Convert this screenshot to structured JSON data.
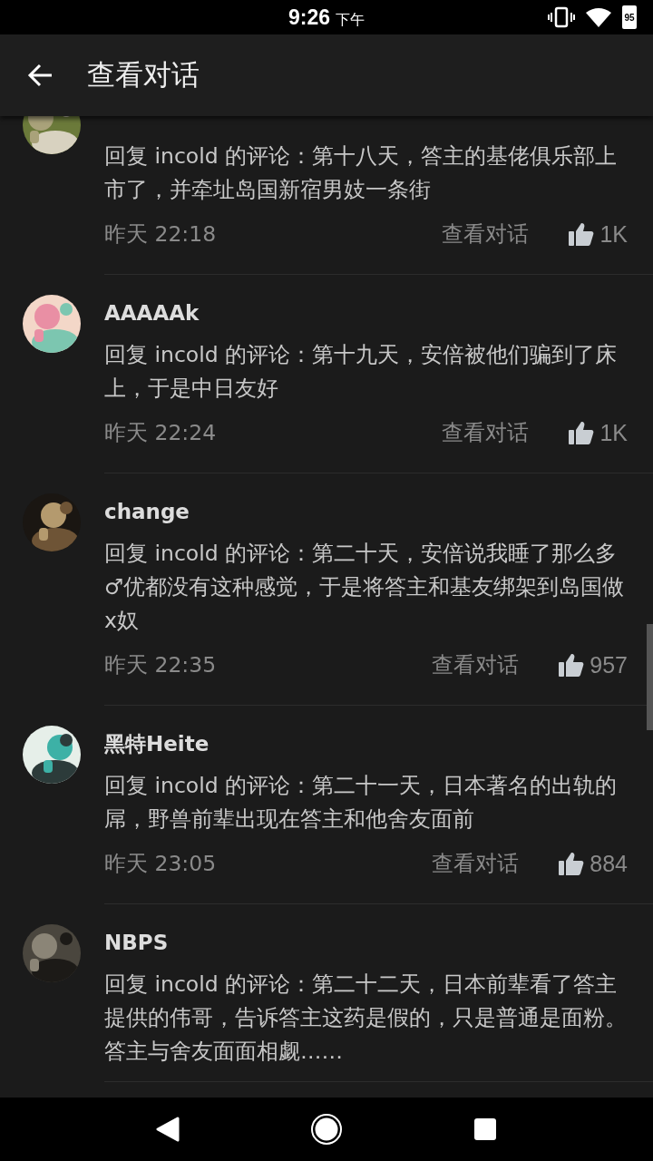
{
  "status_bar": {
    "time": "9:26",
    "period": "下午",
    "battery": "95"
  },
  "app_bar": {
    "title": "查看对话"
  },
  "comments": [
    {
      "body": "回复 incold 的评论：第十八天，答主的基佬俱乐部上市了，并牵址岛国新宿男妓一条街",
      "time": "昨天 22:18",
      "link": "查看对话",
      "likes": "1K"
    },
    {
      "name": "AAAAAk",
      "body": "回复 incold 的评论：第十九天，安倍被他们骗到了床上，于是中日友好",
      "time": "昨天 22:24",
      "link": "查看对话",
      "likes": "1K"
    },
    {
      "name": "change",
      "body": "回复 incold 的评论：第二十天，安倍说我睡了那么多♂优都没有这种感觉，于是将答主和基友绑架到岛国做x奴",
      "time": "昨天 22:35",
      "link": "查看对话",
      "likes": "957"
    },
    {
      "name": "黑特Heite",
      "body": "回复 incold 的评论：第二十一天，日本著名的出轨的屌，野兽前辈出现在答主和他舍友面前",
      "time": "昨天 23:05",
      "link": "查看对话",
      "likes": "884"
    },
    {
      "name": "NBPS",
      "body": "回复 incold 的评论：第二十二天，日本前辈看了答主提供的伟哥，告诉答主这药是假的，只是普通是面粉。答主与舍友面面相觑……"
    }
  ]
}
